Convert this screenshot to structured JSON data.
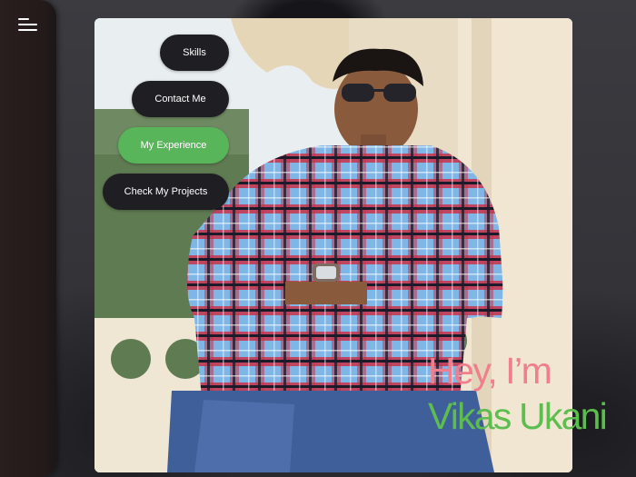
{
  "sidebar": {
    "menu_icon": "hamburger-menu-icon"
  },
  "nav": {
    "items": [
      {
        "label": "Skills",
        "active": false
      },
      {
        "label": "Contact Me",
        "active": false
      },
      {
        "label": "My Experience",
        "active": true
      },
      {
        "label": "Check My Projects",
        "active": false
      }
    ]
  },
  "hero": {
    "greeting": "Hey, I’m",
    "name": "Vikas Ukani"
  },
  "colors": {
    "nav_button": "#1f1e22",
    "nav_active": "#58b55a",
    "greeting": "#ef7f8c",
    "name": "#5dbd4f"
  }
}
